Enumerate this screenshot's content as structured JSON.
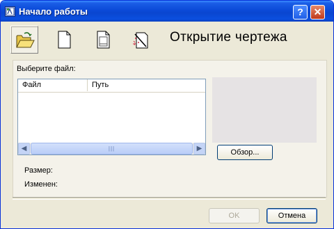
{
  "window": {
    "title": "Начало работы",
    "help_glyph": "?",
    "close_glyph": "✕"
  },
  "toolbar": {
    "items": [
      {
        "name": "open-drawing",
        "icon": "open-folder-icon",
        "selected": true
      },
      {
        "name": "start-from-scratch",
        "icon": "blank-page-icon",
        "selected": false
      },
      {
        "name": "use-template",
        "icon": "template-page-icon",
        "selected": false
      },
      {
        "name": "use-wizard",
        "icon": "wizard-icon",
        "selected": false
      }
    ],
    "heading": "Открытие чертежа"
  },
  "panel": {
    "select_file_label": "Выберите файл:",
    "columns": [
      "Файл",
      "Путь"
    ],
    "rows": [],
    "browse_label": "Обзор...",
    "size_label": "Размер:",
    "modified_label": "Изменен:",
    "scroll_left": "◀",
    "scroll_right": "▶",
    "scroll_grip": "|||"
  },
  "footer": {
    "ok_label": "OK",
    "cancel_label": "Отмена"
  },
  "colors": {
    "titlebar": "#0b4ad8",
    "dialog_bg": "#ece9d8",
    "preview_bg": "#e6e3e4",
    "close_button": "#c0391b"
  }
}
